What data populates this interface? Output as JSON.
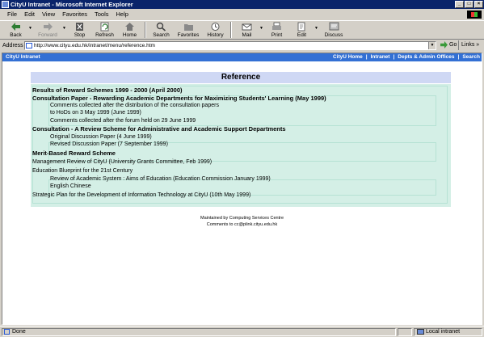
{
  "window": {
    "title": "CityU Intranet - Microsoft Internet Explorer"
  },
  "menu": [
    "File",
    "Edit",
    "View",
    "Favorites",
    "Tools",
    "Help"
  ],
  "toolbar": {
    "back": "Back",
    "forward": "Forward",
    "stop": "Stop",
    "refresh": "Refresh",
    "home": "Home",
    "search": "Search",
    "favorites": "Favorites",
    "history": "History",
    "mail": "Mail",
    "print": "Print",
    "edit": "Edit",
    "discuss": "Discuss"
  },
  "address": {
    "label": "Address",
    "url": "http://www.cityu.edu.hk/intranet/menu/reference.htm",
    "go": "Go",
    "links": "Links"
  },
  "site": {
    "brand": "CityU Intranet",
    "nav": [
      "CityU Home",
      "Intranet",
      "Depts & Admin Offices",
      "Search"
    ]
  },
  "page": {
    "heading": "Reference",
    "items": [
      {
        "text": "Results of Reward Schemes 1999 - 2000 (April 2000)",
        "style": "bold",
        "indent": false
      },
      {
        "text": "Consultation Paper - Rewarding Academic Departments for Maximizing Students' Learning (May 1999)",
        "style": "bold",
        "indent": false
      },
      {
        "text": "Comments collected after the distribution of the consultation papers",
        "style": "normal",
        "indent": true
      },
      {
        "text": "to HoDs on 3 May 1999 (June 1999)",
        "style": "normal",
        "indent": true
      },
      {
        "text": "Comments collected after the forum held on 29 June 1999",
        "style": "normal",
        "indent": true
      },
      {
        "text": "Consultation - A Review Scheme for Administrative and Academic Support Departments",
        "style": "bold",
        "indent": false
      },
      {
        "text": "Original Discussion Paper (4 June 1999)",
        "style": "normal",
        "indent": true
      },
      {
        "text": "Revised Discussion Paper (7 September 1999)",
        "style": "normal",
        "indent": true
      },
      {
        "text": "Merit-Based Reward Scheme",
        "style": "bold",
        "indent": false
      },
      {
        "text": "Management Review of CityU (University Grants Committee, Feb 1999)",
        "style": "normal",
        "indent": false
      },
      {
        "text": "Education Blueprint for the 21st Century",
        "style": "normal",
        "indent": false
      },
      {
        "text": "Review of Academic System : Aims of Education (Education Commission January 1999)",
        "style": "normal",
        "indent": true
      },
      {
        "text": "English Chinese",
        "style": "normal",
        "indent": true
      },
      {
        "text": "Strategic Plan for the Development of Information Technology at CityU (10th May 1999)",
        "style": "normal",
        "indent": false
      }
    ],
    "footer_line1": "Maintained by Computing Services Centre",
    "footer_line2": "Comments to cc@plink.cityu.edu.hk"
  },
  "status": {
    "text": "Done",
    "zone": "Local intranet"
  },
  "colors": {
    "titlebar": "#0a246a",
    "sitebar": "#3370d4",
    "heading_band": "#cfd8f4",
    "panel": "#d4efe6"
  }
}
